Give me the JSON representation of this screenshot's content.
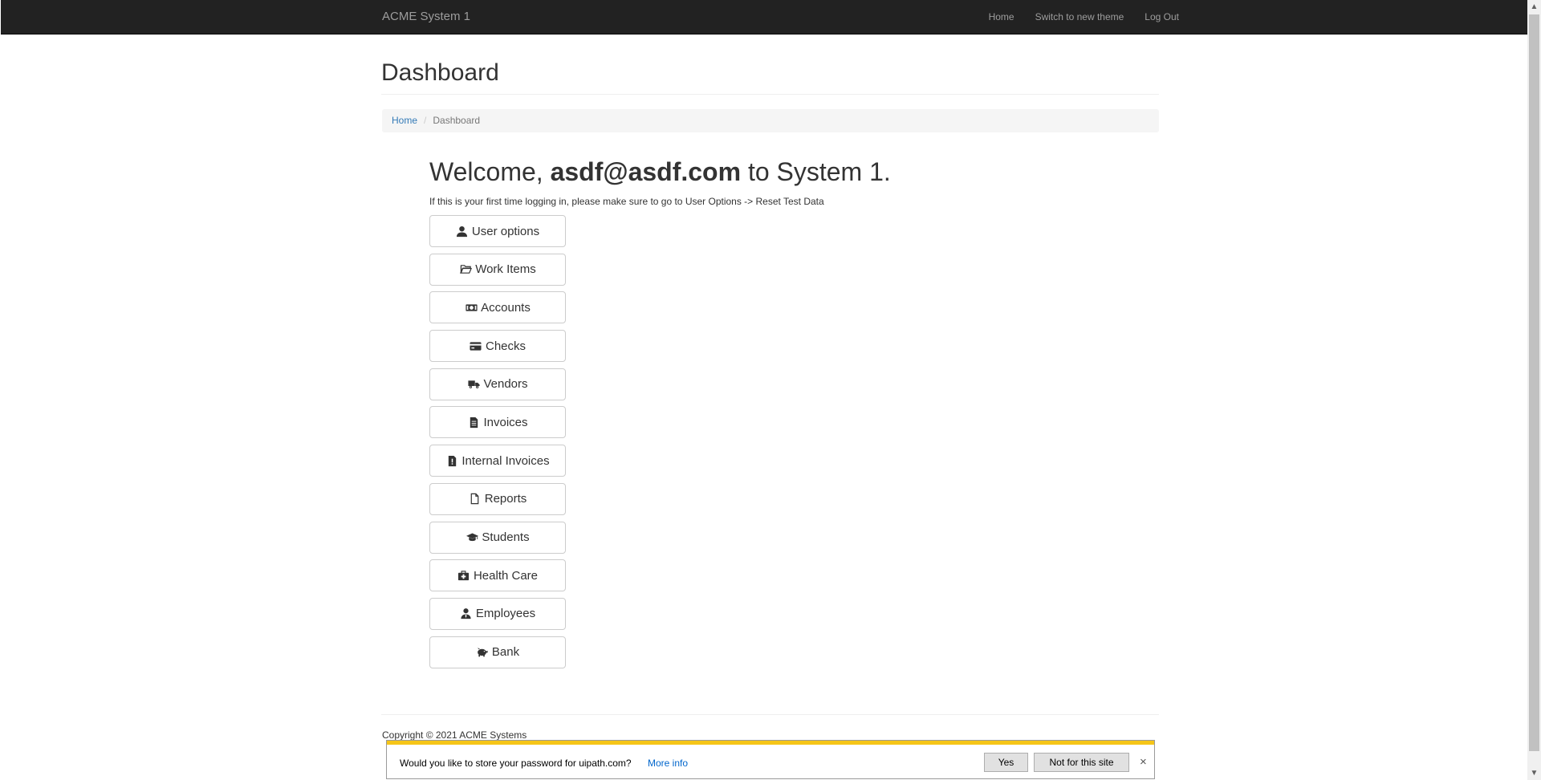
{
  "navbar": {
    "brand": "ACME System 1",
    "links": [
      "Home",
      "Switch to new theme",
      "Log Out"
    ]
  },
  "page": {
    "title": "Dashboard"
  },
  "breadcrumb": {
    "home": "Home",
    "separator": "/",
    "current": "Dashboard"
  },
  "welcome": {
    "prefix": "Welcome, ",
    "user": "asdf@asdf.com",
    "suffix": " to System 1.",
    "hint": "If this is your first time logging in, please make sure to go to User Options -> Reset Test Data"
  },
  "menu": [
    {
      "label": "User options",
      "icon": "user-icon"
    },
    {
      "label": "Work Items",
      "icon": "folder-open-icon"
    },
    {
      "label": "Accounts",
      "icon": "money-icon"
    },
    {
      "label": "Checks",
      "icon": "credit-card-icon"
    },
    {
      "label": "Vendors",
      "icon": "truck-icon"
    },
    {
      "label": "Invoices",
      "icon": "document-icon"
    },
    {
      "label": "Internal Invoices",
      "icon": "document-alert-icon"
    },
    {
      "label": "Reports",
      "icon": "file-icon"
    },
    {
      "label": "Students",
      "icon": "graduation-cap-icon"
    },
    {
      "label": "Health Care",
      "icon": "medkit-icon"
    },
    {
      "label": "Employees",
      "icon": "employee-icon"
    },
    {
      "label": "Bank",
      "icon": "piggy-bank-icon"
    }
  ],
  "footer": {
    "copyright": "Copyright © 2021 ACME Systems"
  },
  "password_prompt": {
    "message": "Would you like to store your password for uipath.com?",
    "more_info": "More info",
    "yes": "Yes",
    "no": "Not for this site",
    "close": "×"
  },
  "colors": {
    "navbar_bg": "#222222",
    "link": "#337ab7",
    "accent": "#f5c518"
  }
}
